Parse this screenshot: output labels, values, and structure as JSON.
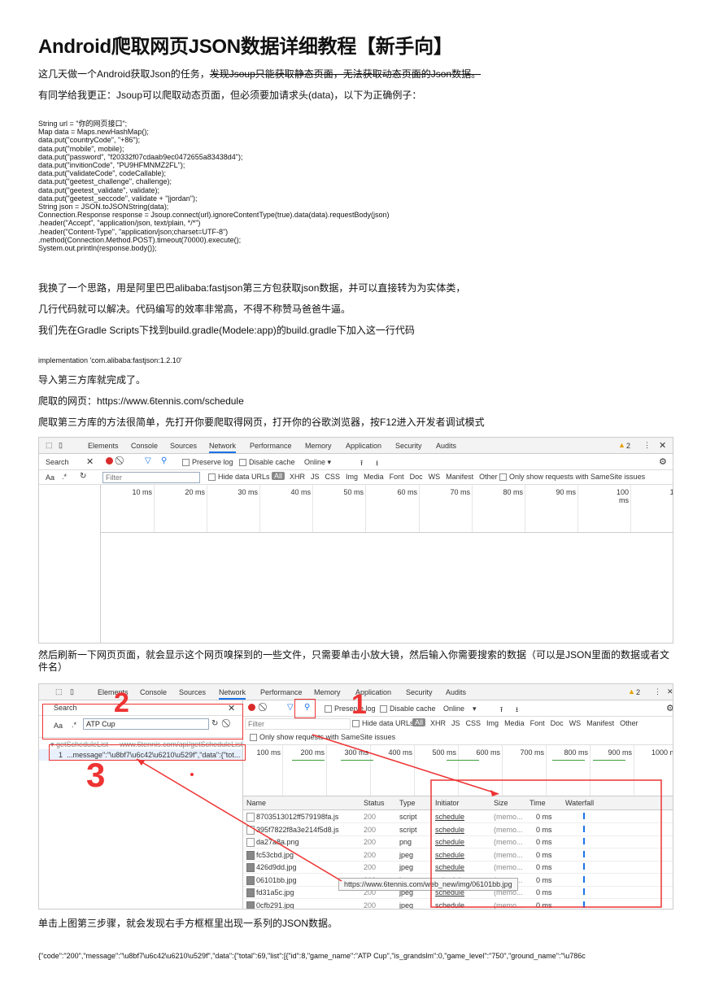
{
  "title": "Android爬取网页JSON数据详细教程【新手向】",
  "para1_normal": "这几天做一个Android获取Json的任务，",
  "para1_strike": "发现Jsoup只能获取静态页面，无法获取动态页面的Json数据。",
  "para2": "有同学给我更正：Jsoup可以爬取动态页面，但必须要加请求头(data)，以下为正确例子：",
  "code_lines": [
    "String url = \"你的网页接口\";",
    "Map data = Maps.newHashMap();",
    "data.put(\"countryCode\", \"+86\");",
    "data.put(\"mobile\", mobile);",
    "data.put(\"password\", \"f20332f07cdaab9ec0472655a83438d4\");",
    "data.put(\"invitionCode\", \"PU9HFMNMZ2FL\");",
    "data.put(\"validateCode\", codeCallable);",
    "data.put(\"geetest_challenge\", challenge);",
    "data.put(\"geetest_validate\", validate);",
    "data.put(\"geetest_seccode\", validate + \"|jordan\");",
    "String json = JSON.toJSONString(data);",
    "Connection.Response response = Jsoup.connect(url).ignoreContentType(true).data(data).requestBody(json)",
    ".header(\"Accept\", \"application/json, text/plain, */*\")",
    ".header(\"Content-Type\", \"application/json;charset=UTF-8\")",
    ".method(Connection.Method.POST).timeout(70000).execute();",
    "System.out.println(response.body());"
  ],
  "para3": "我换了一个思路，用是阿里巴巴alibaba:fastjson第三方包获取json数据，并可以直接转为为实体类，",
  "para4": "几行代码就可以解决。代码编写的效率非常高，不得不称赞马爸爸牛逼。",
  "para5": "我们先在Gradle Scripts下找到build.gradle(Modele:app)的build.gradle下加入这一行代码",
  "impl_line": "implementation 'com.alibaba:fastjson:1.2.10'",
  "para6": "导入第三方库就完成了。",
  "para7": "爬取的网页：https://www.6tennis.com/schedule",
  "para8": "爬取第三方库的方法很简单，先打开你要爬取得网页，打开你的谷歌浏览器，按F12进入开发者调试模式",
  "devtools1": {
    "tabs": [
      "Elements",
      "Console",
      "Sources",
      "Network",
      "Performance",
      "Memory",
      "Application",
      "Security",
      "Audits"
    ],
    "warning": "2",
    "search_tab": "Search",
    "preserve_log": "Preserve log",
    "disable_cache": "Disable cache",
    "throttle": "Online",
    "filter_placeholder": "Filter",
    "hide_data_urls": "Hide data URLs",
    "all": "All",
    "types": [
      "XHR",
      "JS",
      "CSS",
      "Img",
      "Media",
      "Font",
      "Doc",
      "WS",
      "Manifest",
      "Other"
    ],
    "samesite": "Only show requests with SameSite issues",
    "aa": "Aa",
    "regex": ".*",
    "ticks": [
      "10 ms",
      "20 ms",
      "30 ms",
      "40 ms",
      "50 ms",
      "60 ms",
      "70 ms",
      "80 ms",
      "90 ms",
      "100 ms",
      "110"
    ]
  },
  "para9_line1": "然后刷新一下网页页面，就会显示这个网页嗅探到的一些文件，只需要单击小放大镜，然后输入你需要搜索的数据（可以是JSON里面的数据或者文",
  "para9_line2": "件名）",
  "devtools2": {
    "tabs": [
      "Elements",
      "Console",
      "Sources",
      "Network",
      "Performance",
      "Memory",
      "Application",
      "Security",
      "Audits"
    ],
    "warning": "2",
    "search_tab": "Search",
    "search_value": "ATP Cup",
    "aa": "Aa",
    "regex": ".*",
    "result_file": "getScheduleList — www.6tennis.com/api/getScheduleList",
    "result_line_no": "1",
    "result_text": "...message\":\"\\u8bf7\\u6c42\\u6210\\u529f\",\"data\":{\"tot...",
    "preserve_log": "Preserve log",
    "disable_cache": "Disable cache",
    "throttle": "Online",
    "filter_placeholder": "Filter",
    "hide_data_urls": "Hide data URLs",
    "all": "All",
    "types": [
      "XHR",
      "JS",
      "CSS",
      "Img",
      "Media",
      "Font",
      "Doc",
      "WS",
      "Manifest",
      "Other"
    ],
    "samesite": "Only show requests with SameSite issues",
    "ticks": [
      "100 ms",
      "200 ms",
      "300 ms",
      "400 ms",
      "500 ms",
      "600 ms",
      "700 ms",
      "800 ms",
      "900 ms",
      "1000 m"
    ],
    "columns": [
      "Name",
      "Status",
      "Type",
      "Initiator",
      "Size",
      "Time",
      "Waterfall"
    ],
    "rows": [
      {
        "name": "8703513012ff579198fa.js",
        "status": "200",
        "type": "script",
        "initiator": "schedule",
        "size": "(memo...",
        "time": "0 ms"
      },
      {
        "name": "395f7822f8a3e214f5d8.js",
        "status": "200",
        "type": "script",
        "initiator": "schedule",
        "size": "(memo...",
        "time": "0 ms"
      },
      {
        "name": "da27a8a.png",
        "status": "200",
        "type": "png",
        "initiator": "schedule",
        "size": "(memo...",
        "time": "0 ms"
      },
      {
        "name": "fc53cbd.jpg",
        "status": "200",
        "type": "jpeg",
        "initiator": "schedule",
        "size": "(memo...",
        "time": "0 ms"
      },
      {
        "name": "426d9dd.jpg",
        "status": "200",
        "type": "jpeg",
        "initiator": "schedule",
        "size": "(memo...",
        "time": "0 ms"
      },
      {
        "name": "06101bb.jpg",
        "status": "200",
        "type": "jpeg",
        "initiator": "schedule",
        "size": "(memo...",
        "time": "0 ms"
      },
      {
        "name": "fd31a5c.jpg",
        "status": "200",
        "type": "jpeg",
        "initiator": "schedule",
        "size": "(memo...",
        "time": "0 ms"
      },
      {
        "name": "0cfb291.jpg",
        "status": "200",
        "type": "jpeg",
        "initiator": "schedule",
        "size": "(memo...",
        "time": "0 ms"
      }
    ],
    "tooltip": "https://www.6tennis.com/web_new/img/06101bb.jpg",
    "annotations": [
      "1",
      "2",
      "3"
    ]
  },
  "para10": "单击上图第三步骤，就会发现右手方框框里出现一系列的JSON数据。",
  "json_line": "{\"code\":\"200\",\"message\":\"\\u8bf7\\u6c42\\u6210\\u529f\",\"data\":{\"total\":69,\"list\":[{\"id\":8,\"game_name\":\"ATP Cup\",\"is_grandslm\":0,\"game_level\":\"750\",\"ground_name\":\"\\u786c"
}
